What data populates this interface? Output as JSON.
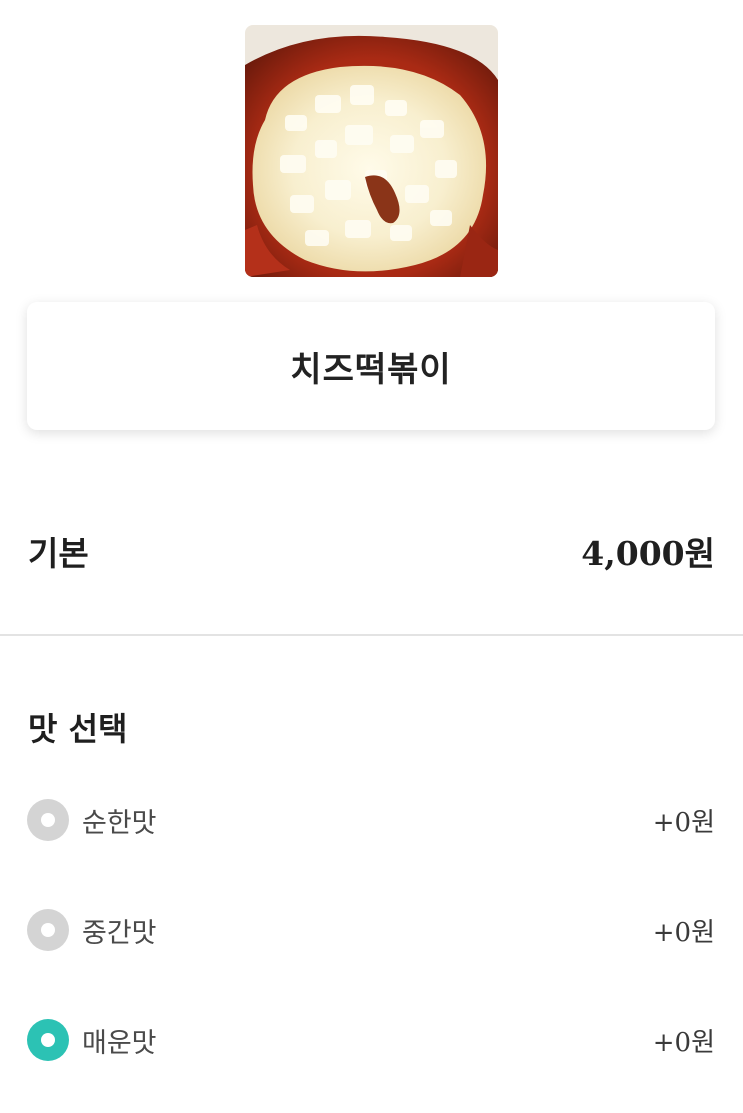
{
  "menu": {
    "item_name": "치즈떡볶이",
    "photo_icon": "cheese-tteokbokki-photo"
  },
  "base": {
    "label": "기본",
    "price": "4,000원"
  },
  "flavor_section": {
    "title": "맛 선택",
    "selected_color": "#2cc2b4",
    "unselected_color": "#d4d4d4",
    "options": [
      {
        "label": "순한맛",
        "price": "+0원",
        "selected": false
      },
      {
        "label": "중간맛",
        "price": "+0원",
        "selected": false
      },
      {
        "label": "매운맛",
        "price": "+0원",
        "selected": true
      }
    ]
  }
}
